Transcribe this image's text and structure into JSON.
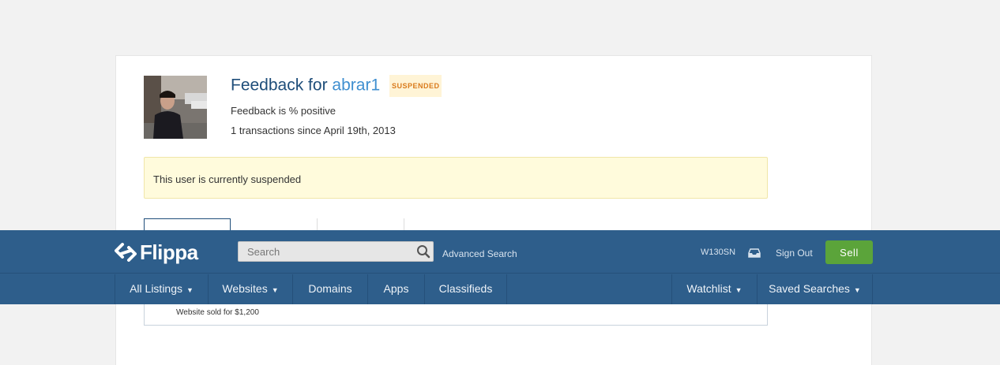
{
  "profile": {
    "title_prefix": "Feedback for",
    "username": "abrar1",
    "status_badge": "SUSPENDED",
    "feedback_line": "Feedback is % positive",
    "transactions_line": "1 transactions since April 19th, 2013"
  },
  "alert": {
    "message": "This user is currently suspended"
  },
  "history": {
    "row_text": "Website sold for $1,200"
  },
  "header": {
    "logo_text": "Flippa",
    "search_placeholder": "Search",
    "advanced_search": "Advanced Search",
    "user_name": "W130SN",
    "sign_out": "Sign Out",
    "sell_label": "Sell"
  },
  "nav": {
    "all_listings": "All Listings",
    "websites": "Websites",
    "domains": "Domains",
    "apps": "Apps",
    "classifieds": "Classifieds",
    "watchlist": "Watchlist",
    "saved_searches": "Saved Searches"
  },
  "colors": {
    "header_bg": "#2e5e8b",
    "sell_button": "#5ba43a",
    "link_blue": "#3f8fd0",
    "title_blue": "#1f4e7a",
    "badge_orange": "#d97a1b",
    "alert_bg": "#fffbdc"
  }
}
